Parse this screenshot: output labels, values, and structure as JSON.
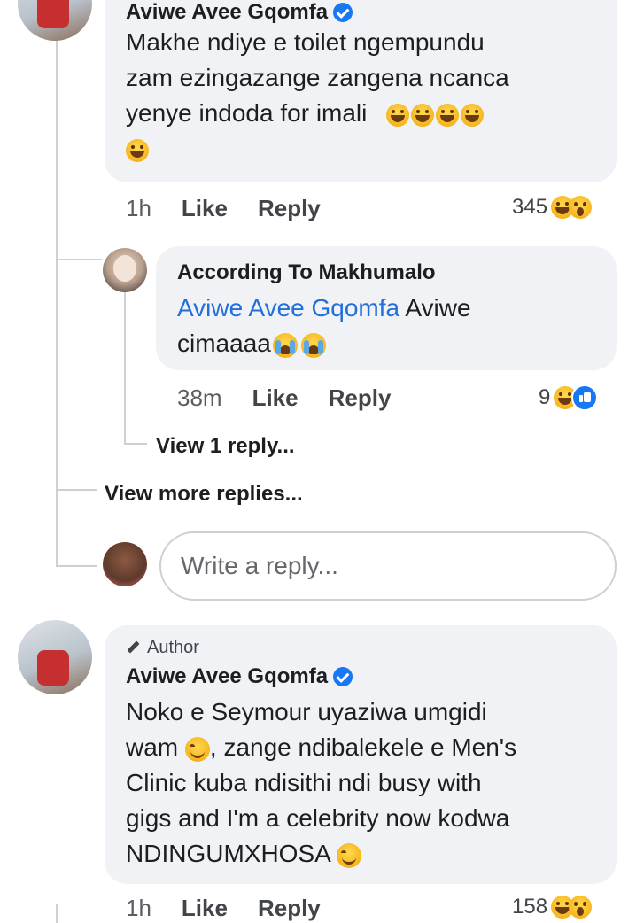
{
  "comment1": {
    "author": "Aviwe Avee Gqomfa",
    "lines": [
      "Makhe ndiye e toilet ngempundu",
      "zam ezingazange zangena ncanca",
      "yenye indoda for imali"
    ],
    "time": "1h",
    "like_label": "Like",
    "reply_label": "Reply",
    "reaction_count": "345"
  },
  "reply1": {
    "author": "According To Makhumalo",
    "mention": "Aviwe Avee Gqomfa",
    "text_after_mention": " Aviwe",
    "line2": "cimaaaa",
    "time": "38m",
    "like_label": "Like",
    "reply_label": "Reply",
    "reaction_count": "9"
  },
  "view_one_reply": "View 1 reply...",
  "view_more_replies": "View more replies...",
  "reply_input": {
    "placeholder": "Write a reply..."
  },
  "comment2": {
    "badge": "Author",
    "author": "Aviwe Avee Gqomfa",
    "line1": "Noko e Seymour uyaziwa umgidi",
    "line2a": "wam ",
    "line2b": ", zange ndibalekele e Men's",
    "line3": "Clinic kuba ndisithi ndi busy with",
    "line4": "gigs and I'm a celebrity now kodwa",
    "line5": "NDINGUMXHOSA ",
    "time": "1h",
    "like_label": "Like",
    "reply_label": "Reply",
    "reaction_count": "158"
  },
  "colors": {
    "bubble": "#f0f2f5",
    "link": "#216fdb",
    "verified": "#1877f2"
  }
}
